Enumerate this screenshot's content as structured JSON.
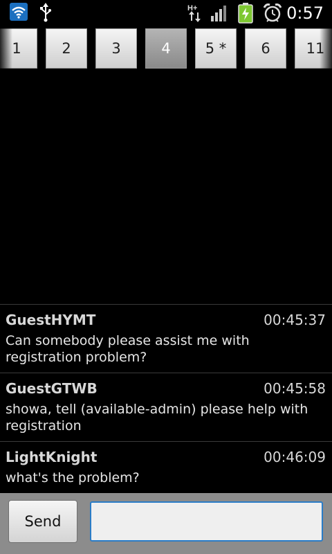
{
  "status_bar": {
    "time": "0:57",
    "icons": [
      "wifi-icon",
      "usb-icon",
      "hspa-icon",
      "signal-icon",
      "battery-charging-icon",
      "alarm-icon"
    ],
    "network_label": "H+"
  },
  "tabs": [
    {
      "label": "1"
    },
    {
      "label": "2"
    },
    {
      "label": "3"
    },
    {
      "label": "4",
      "active": true
    },
    {
      "label": "5 *"
    },
    {
      "label": "6"
    },
    {
      "label": "11"
    }
  ],
  "messages": [
    {
      "user": "GuestHYMT",
      "time": "00:45:37",
      "text": "Can somebody please assist me with registration problem?"
    },
    {
      "user": "GuestGTWB",
      "time": "00:45:58",
      "text": "showa, tell (available-admin) please help with registration"
    },
    {
      "user": "LightKnight",
      "time": "00:46:09",
      "text": "what's the problem?"
    }
  ],
  "composer": {
    "send_label": "Send",
    "input_value": "",
    "input_placeholder": ""
  },
  "colors": {
    "background": "#000000",
    "input_focus": "#2a7cc7",
    "battery": "#7ec832"
  }
}
